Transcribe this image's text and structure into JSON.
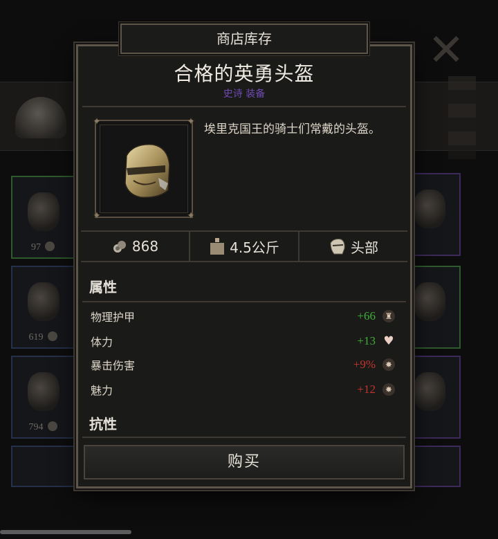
{
  "tab_title": "商店库存",
  "item": {
    "name": "合格的英勇头盔",
    "rarity": "史诗 装备",
    "description": "埃里克国王的骑士们常戴的头盔。"
  },
  "stats": {
    "price": "868",
    "weight": "4.5公斤",
    "slot": "头部"
  },
  "sections": {
    "attributes_label": "属性",
    "resistances_label": "抗性"
  },
  "attributes": [
    {
      "name": "物理护甲",
      "value": "+66",
      "tone": "positive",
      "icon": "armor-icon"
    },
    {
      "name": "体力",
      "value": "+13",
      "tone": "positive",
      "icon": "heart-icon"
    },
    {
      "name": "暴击伤害",
      "value": "+9%",
      "tone": "negative",
      "icon": "crit-icon"
    },
    {
      "name": "魅力",
      "value": "+12",
      "tone": "negative",
      "icon": "charm-icon"
    }
  ],
  "buy_label": "购买",
  "background_prices": [
    "97",
    "619",
    "794"
  ],
  "colors": {
    "positive": "#3fae3a",
    "negative": "#c2352c",
    "rarity_epic": "#6f4bb4"
  }
}
